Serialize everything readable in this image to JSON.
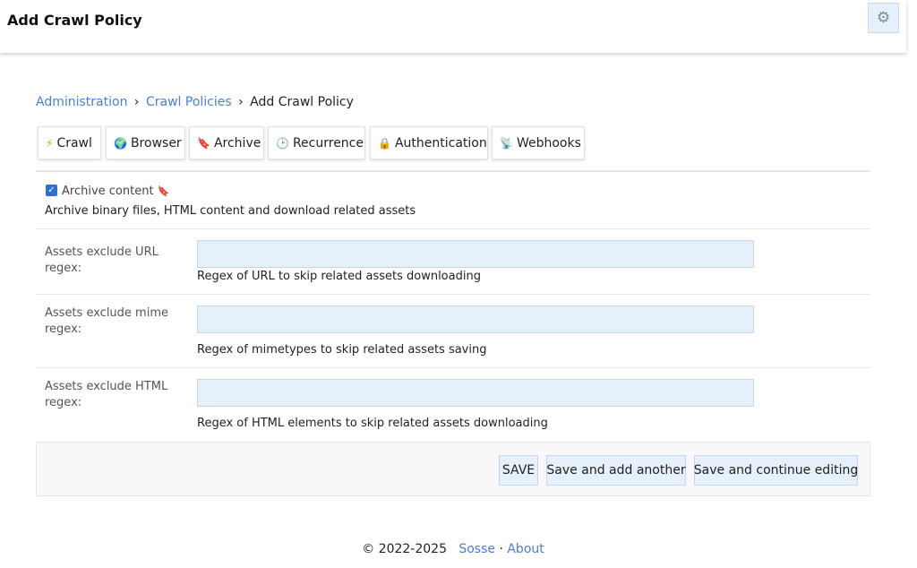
{
  "header": {
    "title": "Add Crawl Policy",
    "theme_icon": "gear-icon"
  },
  "breadcrumb": {
    "items": [
      "Administration",
      "Crawl Policies"
    ],
    "current": "Add Crawl Policy",
    "separator": "›"
  },
  "tabs": [
    {
      "label": "Crawl",
      "icon": "⚡"
    },
    {
      "label": "Browser",
      "icon": "🌍"
    },
    {
      "label": "Archive",
      "icon": "🔖"
    },
    {
      "label": "Recurrence",
      "icon": "🕑"
    },
    {
      "label": "Authentication",
      "icon": "🔒"
    },
    {
      "label": "Webhooks",
      "icon": "📡"
    }
  ],
  "archive": {
    "checkbox_label": "Archive content",
    "checked": true,
    "help": "Archive binary files, HTML content and download related assets"
  },
  "fields": [
    {
      "label": "Assets exclude URL regex:",
      "value": "",
      "help": "Regex of URL to skip related assets downloading"
    },
    {
      "label": "Assets exclude mime regex:",
      "value": "",
      "help": "Regex of mimetypes to skip related assets saving"
    },
    {
      "label": "Assets exclude HTML regex:",
      "value": "",
      "help": "Regex of HTML elements to skip related assets downloading"
    }
  ],
  "buttons": {
    "save": "SAVE",
    "save_add": "Save and add another",
    "save_continue": "Save and continue editing"
  },
  "footer": {
    "copyright": "© 2022-2025",
    "link1": "Sosse",
    "sep": "·",
    "link2": "About"
  }
}
